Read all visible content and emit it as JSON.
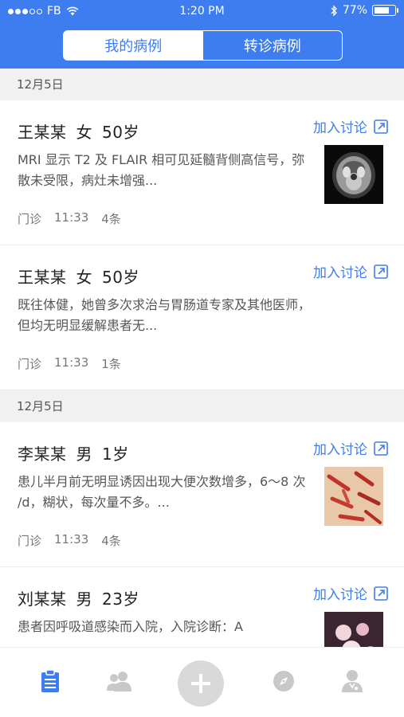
{
  "status_bar": {
    "carrier": "FB",
    "time": "1:20 PM",
    "battery": "77%",
    "battery_level": 0.77
  },
  "segmented_control": {
    "tabs": [
      {
        "label": "我的病例",
        "active": true
      },
      {
        "label": "转诊病例",
        "active": false
      }
    ]
  },
  "sections": [
    {
      "date": "12月5日"
    },
    {
      "date": "12月5日"
    }
  ],
  "cases": [
    {
      "name": "王某某",
      "gender": "女",
      "age": "50岁",
      "description": "MRI 显示 T2 及 FLAIR 相可见延髓背侧高信号，弥散未受限，病灶未增强...",
      "type": "门诊",
      "time": "11:33",
      "count": "4条",
      "action": "加入讨论",
      "thumbnail": "mri-brain-scan"
    },
    {
      "name": "王某某",
      "gender": "女",
      "age": "50岁",
      "description": "既往体健，她曾多次求治与胃肠道专家及其他医师，但均无明显缓解患者无...",
      "type": "门诊",
      "time": "11:33",
      "count": "1条",
      "action": "加入讨论"
    },
    {
      "name": "李某某",
      "gender": "男",
      "age": "1岁",
      "description": "患儿半月前无明显诱因出现大便次数增多，6～8 次 /d，糊状，每次量不多。...",
      "type": "门诊",
      "time": "11:33",
      "count": "4条",
      "action": "加入讨论",
      "thumbnail": "red-bacteria-micrograph"
    },
    {
      "name": "刘某某",
      "gender": "男",
      "age": "23岁",
      "description": "患者因呼吸道感染而入院，入院诊断：A",
      "action": "加入讨论",
      "thumbnail": "pink-cells-micrograph"
    }
  ],
  "tab_bar": {
    "items": [
      {
        "icon": "clipboard-icon",
        "active": true
      },
      {
        "icon": "people-icon",
        "active": false
      },
      {
        "icon": "plus-icon",
        "active": false
      },
      {
        "icon": "compass-icon",
        "active": false
      },
      {
        "icon": "doctor-icon",
        "active": false
      }
    ]
  },
  "colors": {
    "accent": "#3d7df0",
    "inactive_icon": "#c8c8c8",
    "section_bg": "#f1f1f1"
  }
}
